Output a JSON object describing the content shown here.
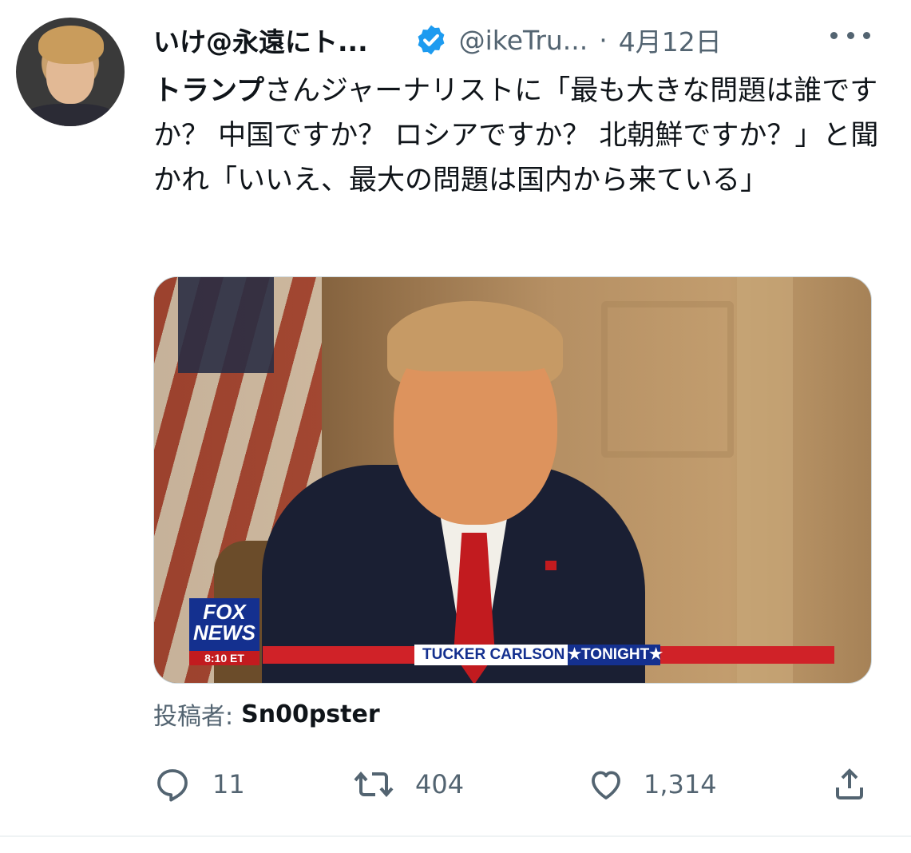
{
  "tweet": {
    "author_name": "いけ@永遠にト...",
    "handle": "@ikeTru...",
    "separator": "·",
    "date": "4月12日",
    "text_bold": "トランプ",
    "text_rest": "さんジャーナリストに「最も大きな問題は誰ですか？ 中国ですか？ ロシアですか？ 北朝鮮ですか？」と聞かれ「いいえ、最大の問題は国内から来ている」",
    "verified_color": "#1d9bf0"
  },
  "media": {
    "network_logo": "FOX NEWS",
    "network_logo_line1": "FOX",
    "network_logo_line2": "NEWS",
    "time": "8:10 ET",
    "show_title": "TUCKER CARLSON",
    "show_tag": "★TONIGHT★"
  },
  "attribution": {
    "label": "投稿者:",
    "user": "Sn00pster"
  },
  "actions": {
    "replies": "11",
    "retweets": "404",
    "likes": "1,314"
  },
  "icons": [
    "reply-icon",
    "retweet-icon",
    "like-icon",
    "share-icon",
    "more-icon",
    "verified-badge-icon"
  ]
}
